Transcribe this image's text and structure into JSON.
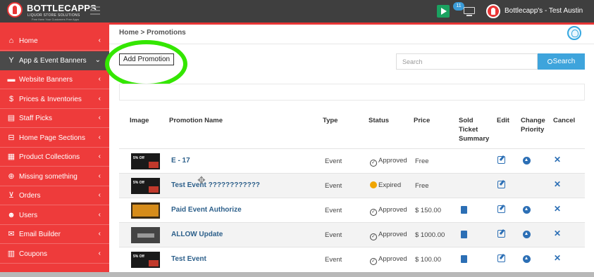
{
  "topbar": {
    "logo_title": "BOTTLECAPPS",
    "logo_sub": "LIQUOR STORE SOLUTIONS",
    "logo_tag": "Free them Your Customers Free Apps",
    "notifications_count": "11",
    "user_name": "Bottlecapp's - Test Austin"
  },
  "sidebar": {
    "items": [
      {
        "label": "Home",
        "icon": "home-icon",
        "glyph": "⌂"
      },
      {
        "label": "App & Event Banners",
        "icon": "trophy-icon",
        "glyph": "Y"
      },
      {
        "label": "Website Banners",
        "icon": "monitor-icon",
        "glyph": "▬"
      },
      {
        "label": "Prices & Inventories",
        "icon": "dollar-icon",
        "glyph": "$"
      },
      {
        "label": "Staff Picks",
        "icon": "card-icon",
        "glyph": "▤"
      },
      {
        "label": "Home Page Sections",
        "icon": "layout-icon",
        "glyph": "⊟"
      },
      {
        "label": "Product Collections",
        "icon": "collection-icon",
        "glyph": "▦"
      },
      {
        "label": "Missing something",
        "icon": "plus-circle-icon",
        "glyph": "⊕"
      },
      {
        "label": "Orders",
        "icon": "cart-icon",
        "glyph": "⊻"
      },
      {
        "label": "Users",
        "icon": "users-icon",
        "glyph": "☻"
      },
      {
        "label": "Email Builder",
        "icon": "envelope-icon",
        "glyph": "✉"
      },
      {
        "label": "Coupons",
        "icon": "barcode-icon",
        "glyph": "▥"
      }
    ],
    "active_index": 1
  },
  "main": {
    "breadcrumb": "Home > Promotions",
    "add_button": "Add Promotion",
    "search_placeholder": "Search",
    "search_button": "Search",
    "columns": [
      "Image",
      "Promotion Name",
      "Type",
      "Status",
      "Price",
      "Sold Ticket Summary",
      "Edit",
      "Change Priority",
      "Cancel"
    ],
    "rows": [
      {
        "name": "E - 17",
        "type": "Event",
        "status": "Approved",
        "status_kind": "approved",
        "price": "Free",
        "has_ticket": false,
        "has_priority": true,
        "thumb_text": "5% Off",
        "thumb_style": "dark"
      },
      {
        "name": "Test Event ????????????",
        "type": "Event",
        "status": "Expired",
        "status_kind": "expired",
        "price": "Free",
        "has_ticket": false,
        "has_priority": false,
        "thumb_text": "5% Off",
        "thumb_style": "dark"
      },
      {
        "name": "Paid Event Authorize",
        "type": "Event",
        "status": "Approved",
        "status_kind": "approved",
        "price": "$ 150.00",
        "has_ticket": true,
        "has_priority": true,
        "thumb_text": "",
        "thumb_style": "orange"
      },
      {
        "name": "ALLOW Update",
        "type": "Event",
        "status": "Approved",
        "status_kind": "approved",
        "price": "$ 1000.00",
        "has_ticket": true,
        "has_priority": true,
        "thumb_text": "",
        "thumb_style": "gray"
      },
      {
        "name": "Test Event",
        "type": "Event",
        "status": "Approved",
        "status_kind": "approved",
        "price": "$ 100.00",
        "has_ticket": true,
        "has_priority": true,
        "thumb_text": "5% Off",
        "thumb_style": "dark"
      }
    ]
  },
  "colors": {
    "sidebar_red": "#ee3b3b",
    "topbar_dark": "#3f3f3f",
    "accent_blue": "#3ea4dc",
    "highlight_green": "#34e600"
  }
}
